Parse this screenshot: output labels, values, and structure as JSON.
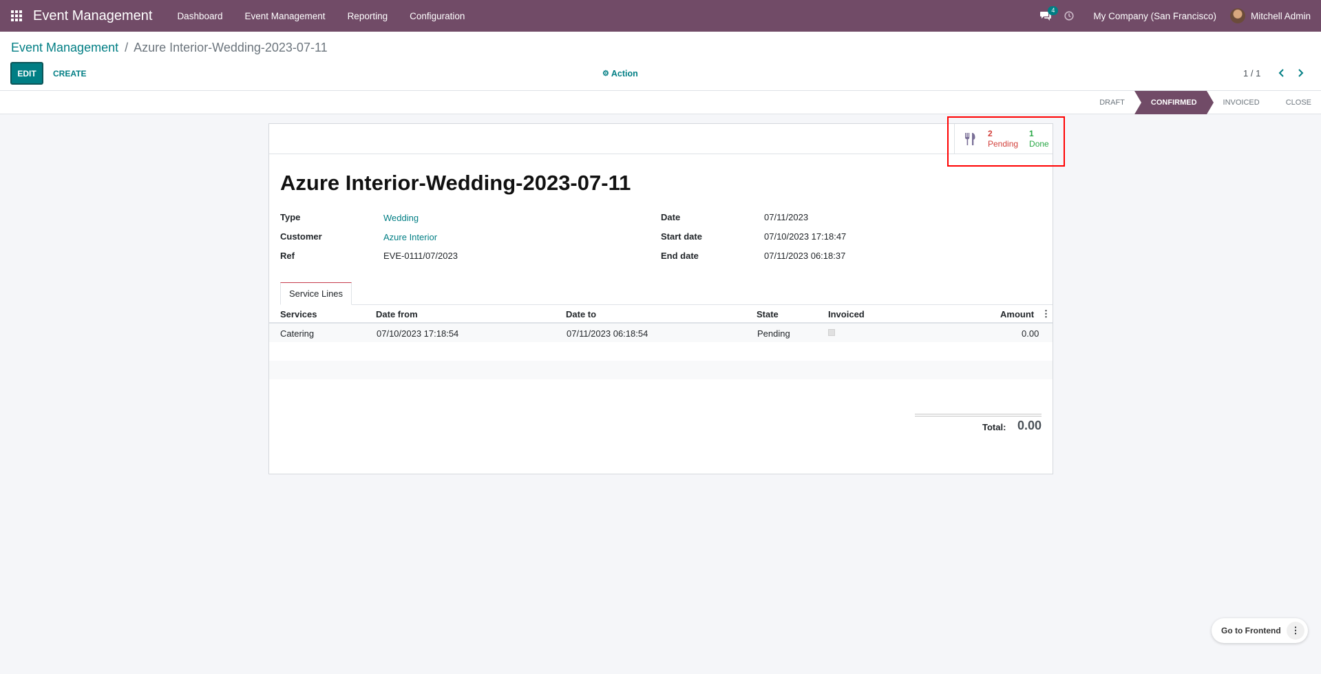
{
  "navbar": {
    "brand": "Event Management",
    "menu": [
      "Dashboard",
      "Event Management",
      "Reporting",
      "Configuration"
    ],
    "chat_count": "4",
    "company": "My Company (San Francisco)",
    "user": "Mitchell Admin"
  },
  "breadcrumb": {
    "parent": "Event Management",
    "separator": "/",
    "current": "Azure Interior-Wedding-2023-07-11"
  },
  "buttons": {
    "edit": "EDIT",
    "create": "CREATE",
    "action": "Action"
  },
  "pager": "1 / 1",
  "stages": [
    "DRAFT",
    "CONFIRMED",
    "INVOICED",
    "CLOSE"
  ],
  "active_stage": "CONFIRMED",
  "smart_button": {
    "pending_count": "2",
    "pending_label": "Pending",
    "done_count": "1",
    "done_label": "Done"
  },
  "record": {
    "title": "Azure Interior-Wedding-2023-07-11",
    "type_label": "Type",
    "type": "Wedding",
    "customer_label": "Customer",
    "customer": "Azure Interior",
    "ref_label": "Ref",
    "ref": "EVE-0111/07/2023",
    "date_label": "Date",
    "date": "07/11/2023",
    "start_label": "Start date",
    "start": "07/10/2023 17:18:47",
    "end_label": "End date",
    "end": "07/11/2023 06:18:37"
  },
  "tab": "Service Lines",
  "table": {
    "headers": [
      "Services",
      "Date from",
      "Date to",
      "State",
      "Invoiced",
      "Amount"
    ],
    "rows": [
      {
        "service": "Catering",
        "date_from": "07/10/2023 17:18:54",
        "date_to": "07/11/2023 06:18:54",
        "state": "Pending",
        "invoiced": false,
        "amount": "0.00"
      }
    ]
  },
  "total": {
    "label": "Total:",
    "value": "0.00"
  },
  "frontend": "Go to Frontend",
  "colors": {
    "brand": "#714b67",
    "accent": "#017e84",
    "pending": "#d23f3a",
    "done": "#28a745"
  }
}
